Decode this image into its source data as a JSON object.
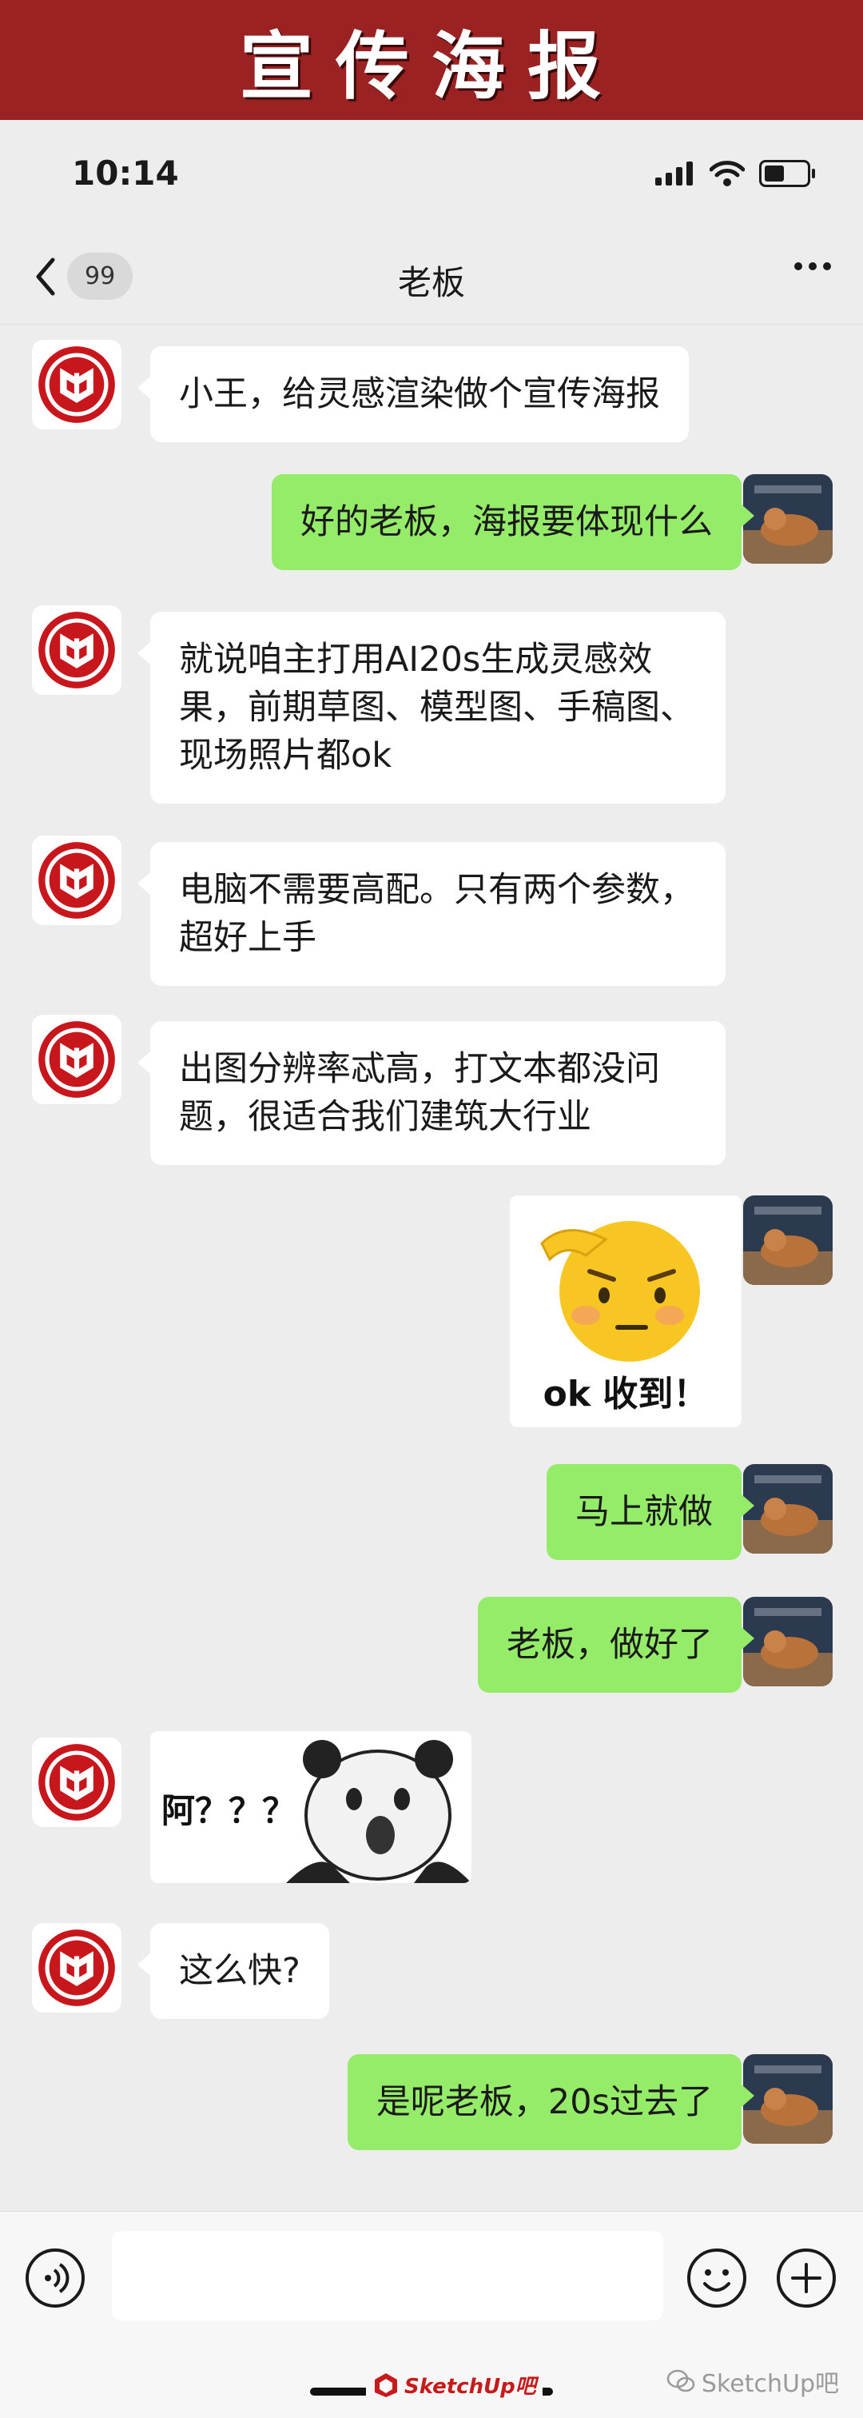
{
  "banner": {
    "title": "宣传海报"
  },
  "status": {
    "time": "10:14"
  },
  "nav": {
    "back_badge": "99",
    "title": "老板"
  },
  "messages": [
    {
      "side": "in",
      "text": "小王，给灵感渲染做个宣传海报"
    },
    {
      "side": "out",
      "text": "好的老板，海报要体现什么"
    },
    {
      "side": "in",
      "text": "就说咱主打用AI20s生成灵感效果，前期草图、模型图、手稿图、现场照片都ok"
    },
    {
      "side": "in",
      "text": "电脑不需要高配。只有两个参数，超好上手"
    },
    {
      "side": "in",
      "text": "出图分辨率忒高，打文本都没问题，很适合我们建筑大行业"
    },
    {
      "side": "out",
      "type": "sticker",
      "caption": "ok 收到！"
    },
    {
      "side": "out",
      "text": "马上就做"
    },
    {
      "side": "out",
      "text": "老板，做好了"
    },
    {
      "side": "in",
      "type": "sticker",
      "caption": "阿？？？"
    },
    {
      "side": "in",
      "text": "这么快?"
    },
    {
      "side": "out",
      "text": "是呢老板，20s过去了"
    }
  ],
  "input": {
    "placeholder": ""
  },
  "watermark": {
    "logo_text": "SketchUp吧",
    "account": "SketchUp吧"
  },
  "colors": {
    "banner": "#9b2222",
    "out_bubble": "#95ec69",
    "in_bubble": "#ffffff",
    "background": "#ededed"
  }
}
